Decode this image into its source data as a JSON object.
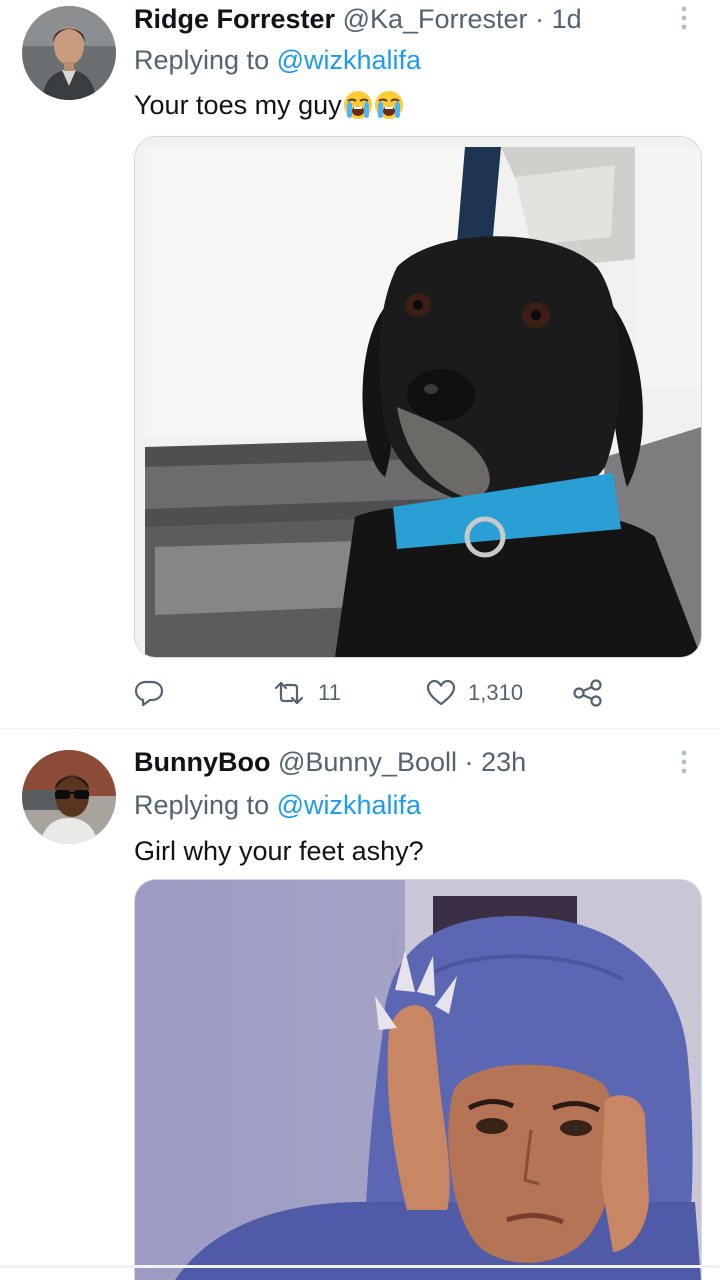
{
  "tweets": [
    {
      "display_name": "Ridge Forrester",
      "handle": "@Ka_Forrester",
      "separator": "·",
      "time": "1d",
      "replying_prefix": "Replying to",
      "replying_to": "@wizkhalifa",
      "text": "Your toes my guy",
      "emoji": "loudly-crying-face",
      "emoji_count": 2,
      "replies_icon": "reply-icon",
      "retweets": "11",
      "likes": "1,310"
    },
    {
      "display_name": "BunnyBoo",
      "handle": "@Bunny_Booll",
      "separator": "·",
      "time": "23h",
      "replying_prefix": "Replying to",
      "replying_to": "@wizkhalifa",
      "text": "Girl why your feet ashy?"
    }
  ],
  "colors": {
    "text": "#0f1419",
    "secondary": "#536471",
    "link": "#1d9bf0",
    "border": "#cfd9de"
  }
}
